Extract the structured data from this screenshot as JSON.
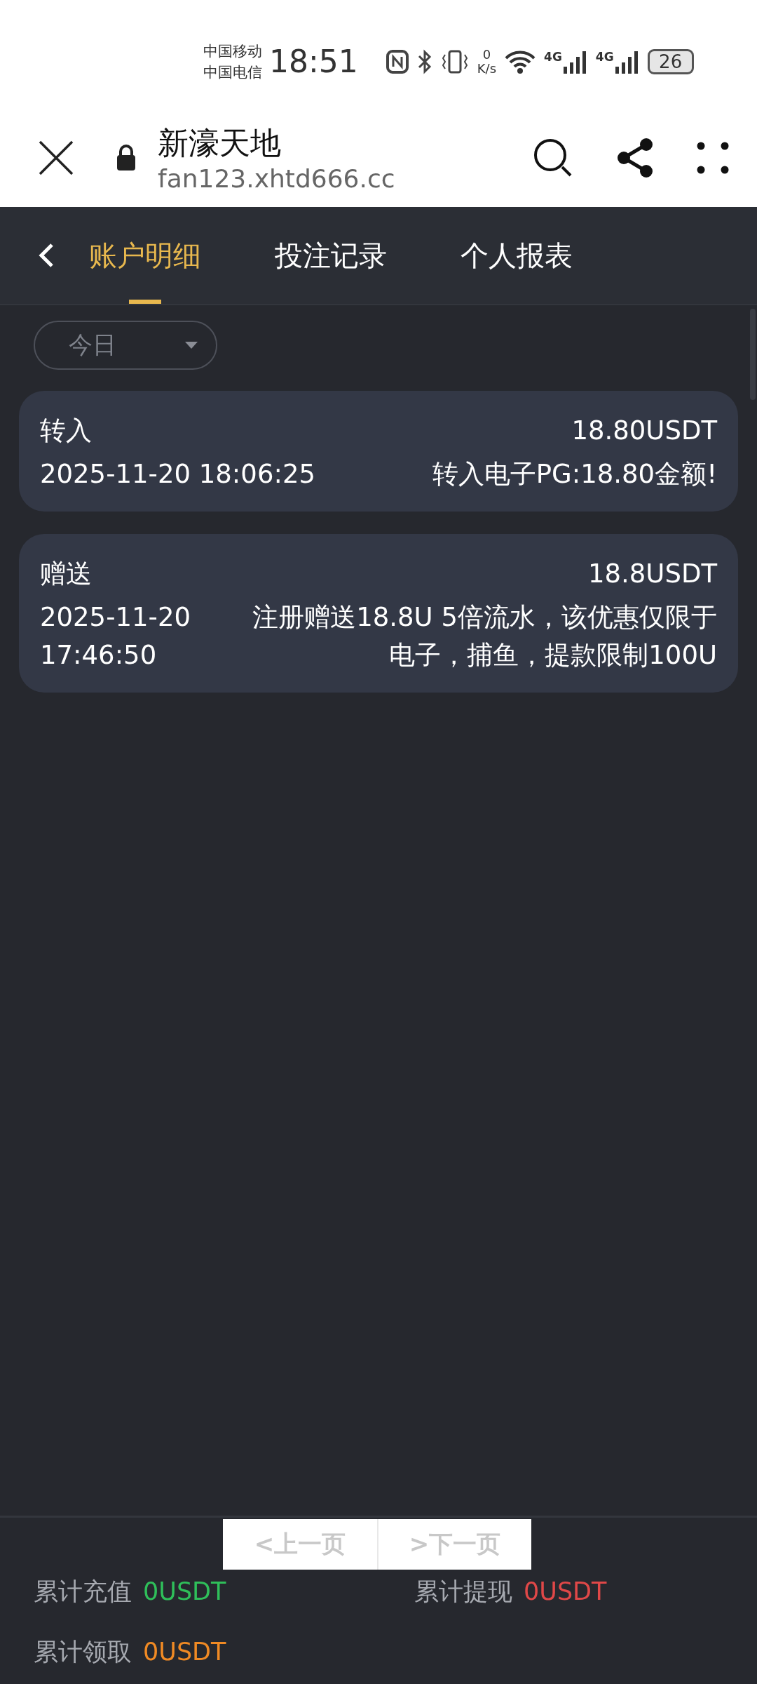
{
  "status_bar": {
    "carriers": [
      "中国移动",
      "中国电信"
    ],
    "time": "18:51",
    "net_speed_value": "0",
    "net_speed_unit": "K/s",
    "signal_labels": [
      "4G",
      "4G"
    ],
    "battery": "26"
  },
  "browser": {
    "title": "新濠天地",
    "url": "fan123.xhtd666.cc"
  },
  "tabs": [
    {
      "label": "账户明细",
      "selected": true
    },
    {
      "label": "投注记录",
      "selected": false
    },
    {
      "label": "个人报表",
      "selected": false
    }
  ],
  "filter": {
    "value": "今日"
  },
  "records": [
    {
      "type": "转入",
      "amount": "18.80USDT",
      "date": "2025-11-20 18:06:25",
      "note": "转入电子PG:18.80金额!"
    },
    {
      "type": "赠送",
      "amount": "18.8USDT",
      "date": "2025-11-20 17:46:50",
      "note": "注册赠送18.8U 5倍流水，该优惠仅限于电子，捕鱼，提款限制100U"
    }
  ],
  "pagination": {
    "prev": "<上一页",
    "next": ">下一页"
  },
  "summary": [
    {
      "label": "累计充值",
      "value": "0USDT",
      "color": "#2fbf5a"
    },
    {
      "label": "累计提现",
      "value": "0USDT",
      "color": "#e04848"
    },
    {
      "label": "累计领取",
      "value": "0USDT",
      "color": "#f08a24"
    }
  ]
}
